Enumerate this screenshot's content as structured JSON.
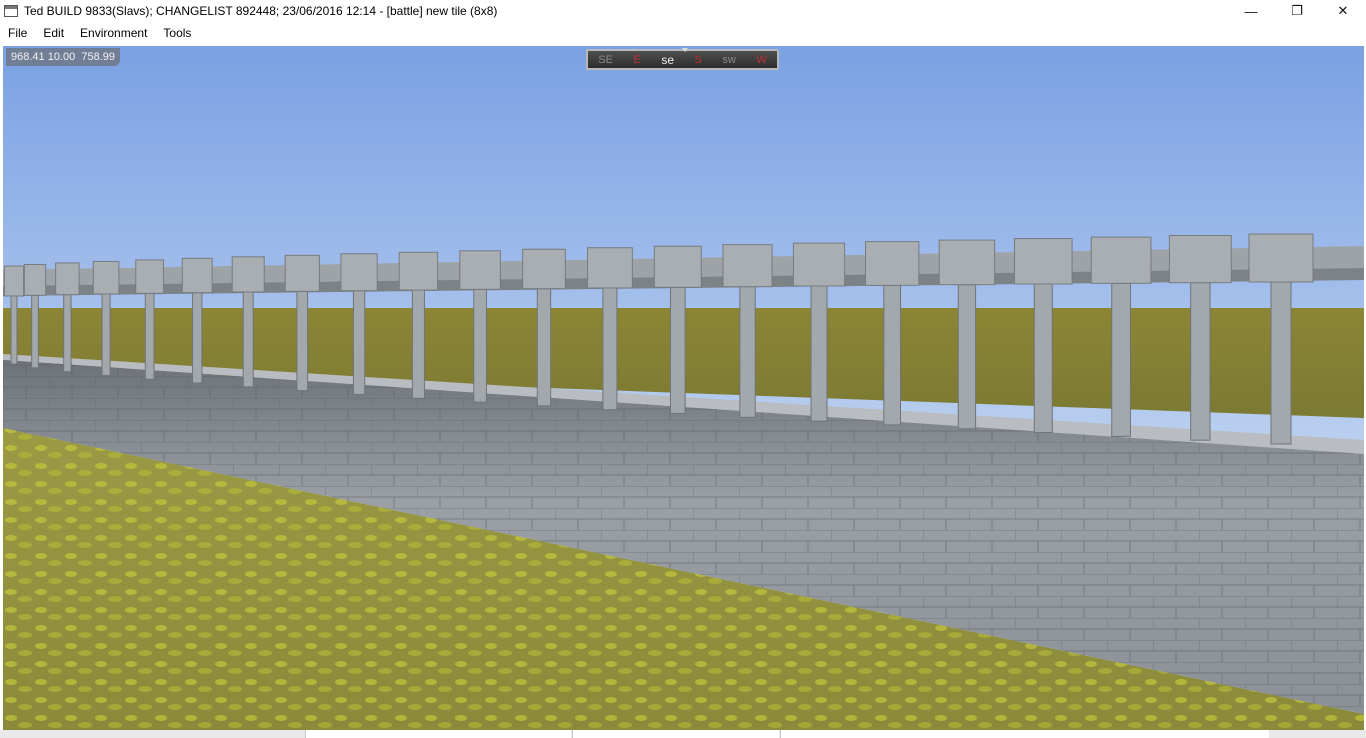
{
  "window": {
    "title": "Ted BUILD 9833(Slavs); CHANGELIST 892448; 23/06/2016 12:14 - [battle] new tile (8x8)",
    "minimize_glyph": "—",
    "maximize_glyph": "❐",
    "close_glyph": "✕"
  },
  "menu": {
    "items": [
      "File",
      "Edit",
      "Environment",
      "Tools"
    ]
  },
  "viewport": {
    "coordinates": "968.41 10.00  758.99",
    "compass": {
      "labels": [
        "SE",
        "E",
        "se",
        "S",
        "sw",
        "W"
      ],
      "current": "se"
    },
    "colors": {
      "sky_top": "#7ea4e4",
      "sky_horizon": "#dfe9f8",
      "ground": "#8f8a3a",
      "stone": "#9aa0a6"
    }
  }
}
